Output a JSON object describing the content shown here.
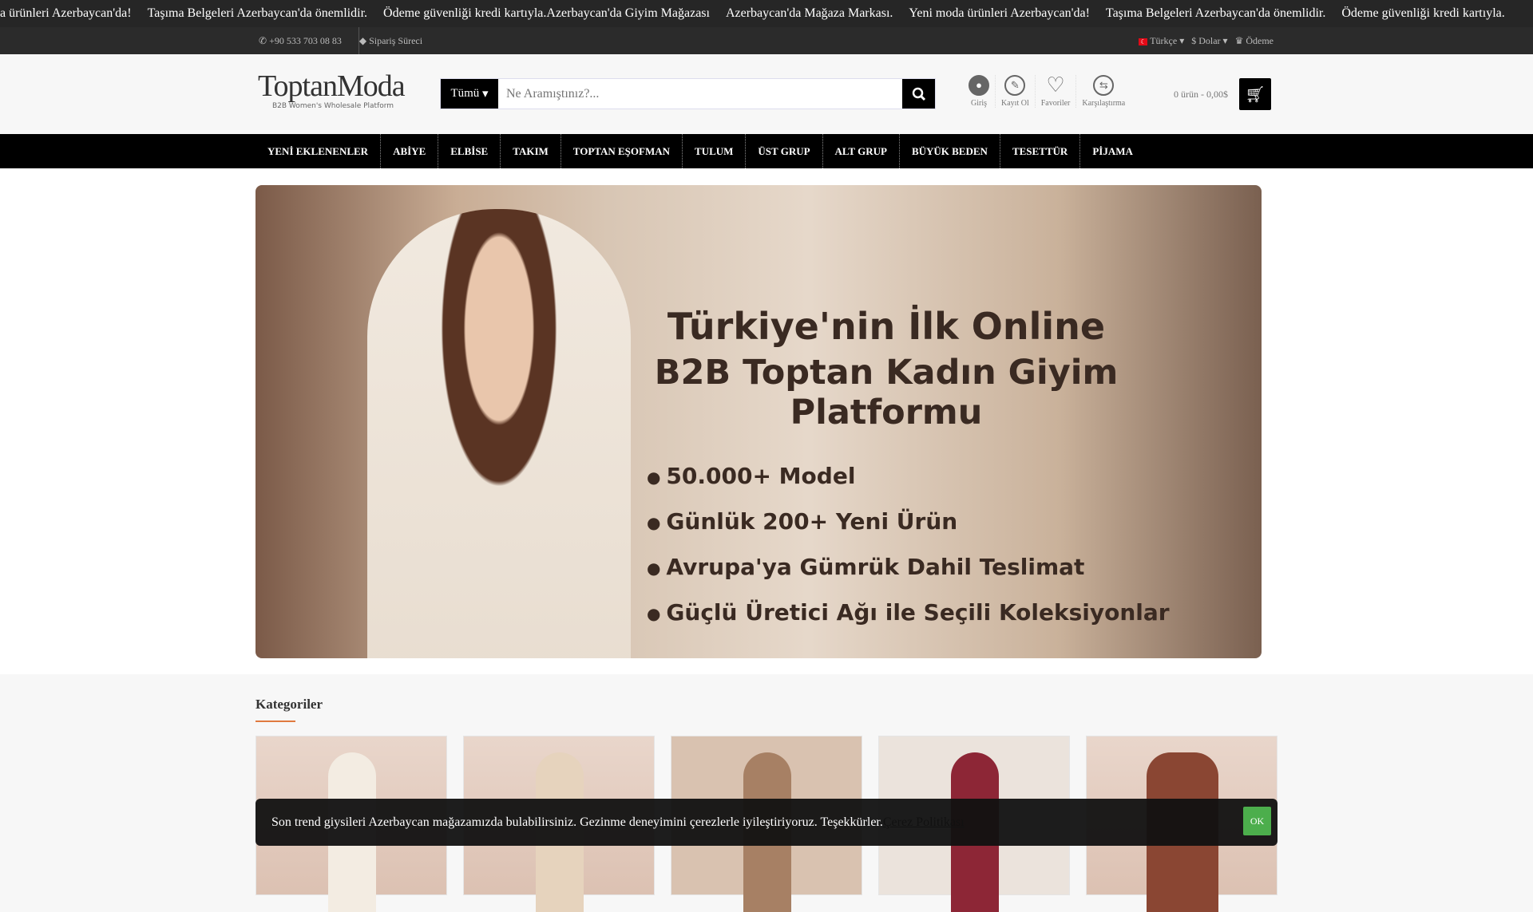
{
  "ticker": [
    "a ürünleri Azerbaycan'da!",
    "Taşıma Belgeleri Azerbaycan'da önemlidir.",
    "Ödeme güvenliği kredi kartıyla.Azerbaycan'da Giyim Mağazası",
    "Azerbaycan'da Mağaza Markası.",
    "Yeni moda ürünleri Azerbaycan'da!",
    "Taşıma Belgeleri Azerbaycan'da önemlidir.",
    "Ödeme güvenliği kredi kartıyla."
  ],
  "infobar": {
    "phone": "+90 533 703 08 83",
    "order_process": "Sipariş Süreci",
    "language": "Türkçe",
    "currency": "$ Dolar",
    "payment": "Ödeme"
  },
  "logo": {
    "name": "ToptanModa",
    "tagline": "B2B Women's Wholesale Platform"
  },
  "search": {
    "category": "Tümü",
    "placeholder": "Ne Aramıştınız?..."
  },
  "user_icons": [
    {
      "label": "Giriş",
      "icon": "user-icon"
    },
    {
      "label": "Kayıt Ol",
      "icon": "pencil-icon"
    },
    {
      "label": "Favoriler",
      "icon": "heart-icon"
    },
    {
      "label": "Karşılaştırma",
      "icon": "compare-icon"
    }
  ],
  "cart": {
    "summary": "0 ürün - 0,00$"
  },
  "nav": [
    "YENİ EKLENENLER",
    "ABİYE",
    "ELBİSE",
    "TAKIM",
    "TOPTAN EŞOFMAN",
    "TULUM",
    "ÜST GRUP",
    "ALT GRUP",
    "BÜYÜK BEDEN",
    "TESETTÜR",
    "PİJAMA"
  ],
  "banner": {
    "title1": "Türkiye'nin İlk Online",
    "title2": "B2B Toptan Kadın Giyim Platformu",
    "bullets": [
      "50.000+ Model",
      "Günlük 200+ Yeni Ürün",
      "Avrupa'ya Gümrük Dahil Teslimat",
      "Güçlü Üretici Ağı ile Seçili Koleksiyonlar"
    ]
  },
  "categories": {
    "title": "Kategoriler"
  },
  "cookie": {
    "text": "Son trend giysileri Azerbaycan mağazamızda bulabilirsiniz. Gezinme deneyimini çerezlerle iyileştiriyoruz. Teşekkürler.",
    "link": "Çerez Politikası",
    "ok": "OK"
  }
}
